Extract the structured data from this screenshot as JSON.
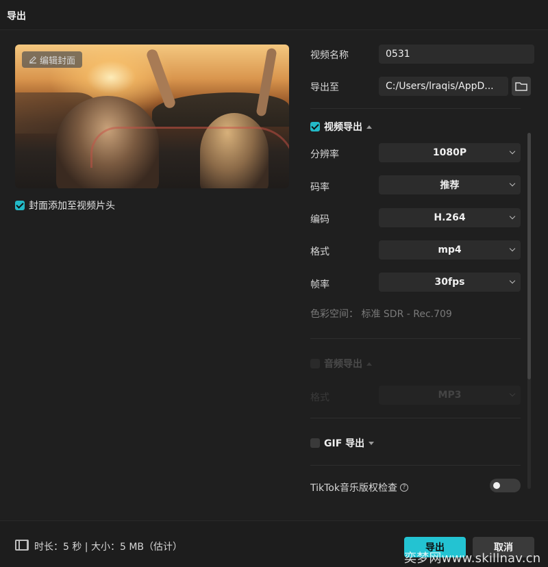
{
  "window": {
    "title": "导出"
  },
  "cover": {
    "edit_label": "编辑封面",
    "add_to_head_label": "封面添加至视频片头",
    "add_to_head_checked": true
  },
  "video_name": {
    "label": "视频名称",
    "value": "0531"
  },
  "export_to": {
    "label": "导出至",
    "value": "C:/Users/lraqis/AppD..."
  },
  "video_section": {
    "title": "视频导出",
    "checked": true,
    "resolution": {
      "label": "分辨率",
      "value": "1080P"
    },
    "bitrate": {
      "label": "码率",
      "value": "推荐"
    },
    "codec": {
      "label": "编码",
      "value": "H.264"
    },
    "format": {
      "label": "格式",
      "value": "mp4"
    },
    "framerate": {
      "label": "帧率",
      "value": "30fps"
    },
    "color_space": "色彩空间： 标准 SDR - Rec.709"
  },
  "audio_section": {
    "title": "音频导出",
    "format_label": "格式",
    "format_value": "MP3",
    "checked": false
  },
  "gif_section": {
    "title": "GIF 导出",
    "checked": false
  },
  "tiktok": {
    "label": "TikTok音乐版权检查",
    "enabled": false
  },
  "footer": {
    "summary": "时长：5 秒 | 大小：5 MB（估计）",
    "export_button": "导出",
    "cancel_button": "取消",
    "watermark": "奕梦网www.skillnav.cn"
  },
  "colors": {
    "accent": "#23c3d2",
    "background": "#1f1f1f",
    "field": "#2c2c2c"
  }
}
